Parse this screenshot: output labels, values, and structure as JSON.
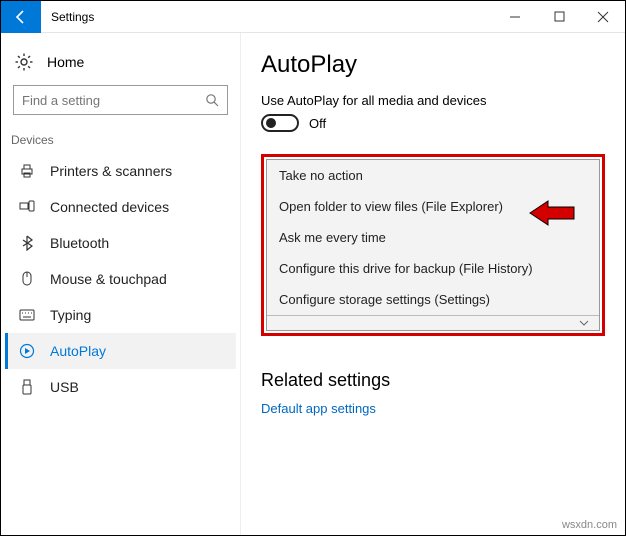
{
  "titlebar": {
    "title": "Settings"
  },
  "sidebar": {
    "home": "Home",
    "search_placeholder": "Find a setting",
    "group": "Devices",
    "items": [
      {
        "label": "Printers & scanners"
      },
      {
        "label": "Connected devices"
      },
      {
        "label": "Bluetooth"
      },
      {
        "label": "Mouse & touchpad"
      },
      {
        "label": "Typing"
      },
      {
        "label": "AutoPlay"
      },
      {
        "label": "USB"
      }
    ]
  },
  "content": {
    "heading": "AutoPlay",
    "subtext": "Use AutoPlay for all media and devices",
    "toggle_label": "Off",
    "dropdown": [
      "Take no action",
      "Open folder to view files (File Explorer)",
      "Ask me every time",
      "Configure this drive for backup (File History)",
      "Configure storage settings (Settings)"
    ],
    "related_heading": "Related settings",
    "related_link": "Default app settings"
  },
  "watermark": "wsxdn.com"
}
